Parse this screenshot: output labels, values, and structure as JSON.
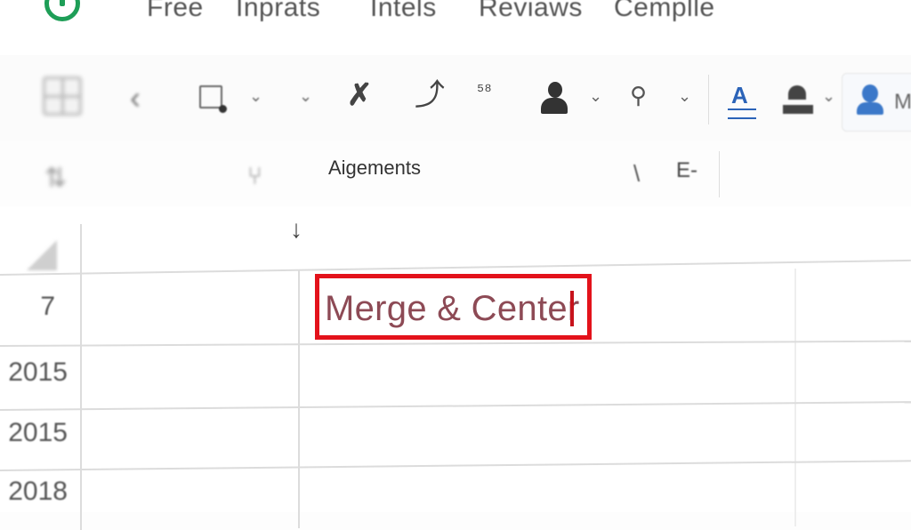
{
  "menu": {
    "items": [
      "Free",
      "Inprats",
      "Intels",
      "Reviaws",
      "Cemplle"
    ]
  },
  "toolbar": {
    "second_row": {
      "alignments_label": "Aigements",
      "e_dropdown_label": "E-"
    },
    "account_label": "M",
    "font_icon_letter": "A"
  },
  "icons": {
    "back": "‹",
    "caret": "⌄",
    "down_arrow": "↓",
    "slash": "\\",
    "scribble": "✗",
    "line_chart": "⤴",
    "formula": "⁵⁸",
    "connector": "⚲"
  },
  "sheet": {
    "row_headers": [
      "7",
      "2015",
      "2015",
      "2018"
    ],
    "active_cell_text": "Merge & Center"
  },
  "colors": {
    "highlight_border": "#e3121b",
    "accent_blue": "#2b63b8",
    "logo_green": "#1e9e57"
  }
}
